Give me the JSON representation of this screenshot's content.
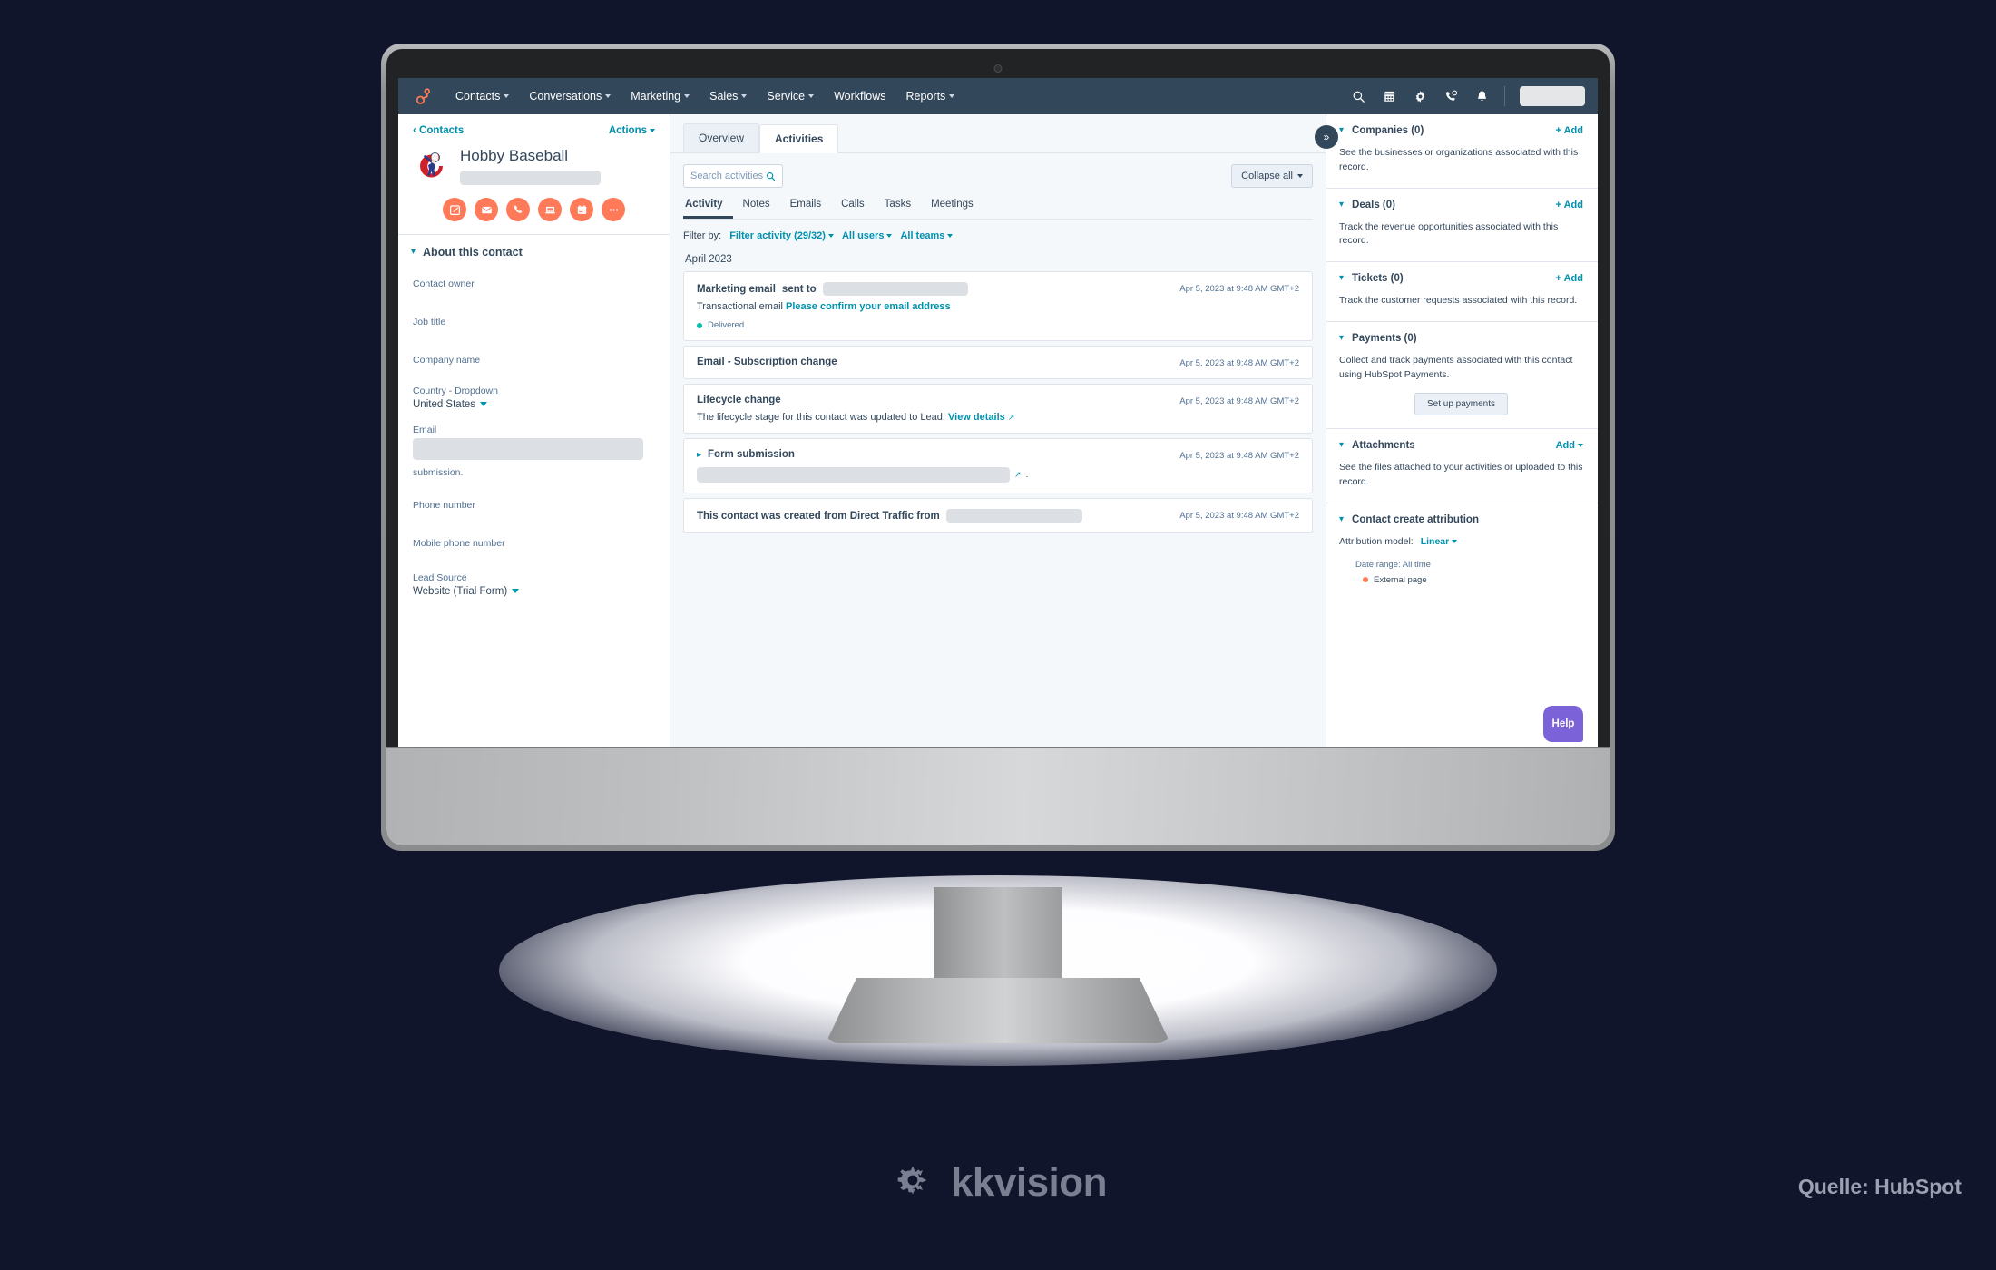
{
  "topnav": {
    "logo": "hubspot-sprocket-logo",
    "items": [
      {
        "label": "Contacts",
        "caret": true
      },
      {
        "label": "Conversations",
        "caret": true
      },
      {
        "label": "Marketing",
        "caret": true
      },
      {
        "label": "Sales",
        "caret": true
      },
      {
        "label": "Service",
        "caret": true
      },
      {
        "label": "Workflows",
        "caret": false
      },
      {
        "label": "Reports",
        "caret": true
      }
    ],
    "icons": [
      "search-icon",
      "marketplace-icon",
      "settings-gear-icon",
      "phone-notification-icon",
      "notifications-bell-icon"
    ]
  },
  "left": {
    "breadcrumb": "Contacts",
    "actions_label": "Actions",
    "contact_name": "Hobby Baseball",
    "contact_email_redacted": "",
    "action_buttons": [
      "note-icon",
      "email-icon",
      "call-icon",
      "task-icon",
      "meeting-icon",
      "more-icon"
    ],
    "section_title": "About this contact",
    "fields": [
      {
        "label": "Contact owner",
        "value": ""
      },
      {
        "label": "Job title",
        "value": ""
      },
      {
        "label": "Company name",
        "value": ""
      },
      {
        "label": "Country - Dropdown",
        "value": "United States",
        "dropdown": true
      },
      {
        "label": "Email",
        "value": "",
        "redacted": true
      },
      {
        "label": "submission.",
        "value": "",
        "plain": true
      },
      {
        "label": "Phone number",
        "value": ""
      },
      {
        "label": "Mobile phone number",
        "value": ""
      },
      {
        "label": "Lead Source",
        "value": "Website (Trial Form)",
        "dropdown": true
      }
    ]
  },
  "center": {
    "tabs": [
      {
        "label": "Overview",
        "active": false
      },
      {
        "label": "Activities",
        "active": true
      }
    ],
    "search_placeholder": "Search activities",
    "collapse_label": "Collapse all",
    "subtabs": [
      {
        "label": "Activity",
        "active": true
      },
      {
        "label": "Notes",
        "active": false
      },
      {
        "label": "Emails",
        "active": false
      },
      {
        "label": "Calls",
        "active": false
      },
      {
        "label": "Tasks",
        "active": false
      },
      {
        "label": "Meetings",
        "active": false
      }
    ],
    "filter_label": "Filter by:",
    "filters": [
      "Filter activity (29/32)",
      "All users",
      "All teams"
    ],
    "month_group": "April 2023",
    "activities": [
      {
        "type": "marketing-email",
        "title": "Marketing email",
        "title_suffix": " sent to",
        "redacted_inline": true,
        "date": "Apr 5, 2023 at 9:48 AM GMT+2",
        "sub_prefix": "Transactional email ",
        "sub_link": "Please confirm your email address",
        "status": "Delivered"
      },
      {
        "type": "subscription-change",
        "title": "Email - Subscription change",
        "date": "Apr 5, 2023 at 9:48 AM GMT+2"
      },
      {
        "type": "lifecycle-change",
        "title": "Lifecycle change",
        "date": "Apr 5, 2023 at 9:48 AM GMT+2",
        "sub_prefix": "The lifecycle stage for this contact was updated to Lead. ",
        "sub_link": "View details"
      },
      {
        "type": "form-submission",
        "title": "Form submission",
        "expandable": true,
        "date": "Apr 5, 2023 at 9:48 AM GMT+2",
        "redacted_body": true
      },
      {
        "type": "contact-created",
        "title": "This contact was created from Direct Traffic from",
        "redacted_inline": true,
        "date": "Apr 5, 2023 at 9:48 AM GMT+2"
      }
    ]
  },
  "right": {
    "expander_icon": "double-chevron-right-icon",
    "sections": [
      {
        "title": "Companies (0)",
        "action": "+ Add",
        "description": "See the businesses or organizations associated with this record."
      },
      {
        "title": "Deals (0)",
        "action": "+ Add",
        "description": "Track the revenue opportunities associated with this record."
      },
      {
        "title": "Tickets (0)",
        "action": "+ Add",
        "description": "Track the customer requests associated with this record."
      },
      {
        "title": "Payments (0)",
        "action": "",
        "description": "Collect and track payments associated with this contact using HubSpot Payments.",
        "button": "Set up payments"
      },
      {
        "title": "Attachments",
        "action": "Add",
        "action_caret": true,
        "description": "See the files attached to your activities or uploaded to this record."
      },
      {
        "title": "Contact create attribution",
        "action": "",
        "attribution_label": "Attribution model:",
        "attribution_value": "Linear",
        "date_range": "Date range: All time",
        "legend": "External page"
      }
    ],
    "help_label": "Help"
  },
  "footer": {
    "brand": "kkvision",
    "brand_icon": "gear-sun-icon",
    "source": "Quelle: HubSpot"
  },
  "colors": {
    "navbar": "#33475b",
    "accent_teal": "#0091ae",
    "accent_orange": "#ff7a59",
    "status_green": "#00bda5",
    "help_purple": "#7c62d9",
    "page_bg": "#11152b",
    "app_bg": "#f5f8fa"
  }
}
